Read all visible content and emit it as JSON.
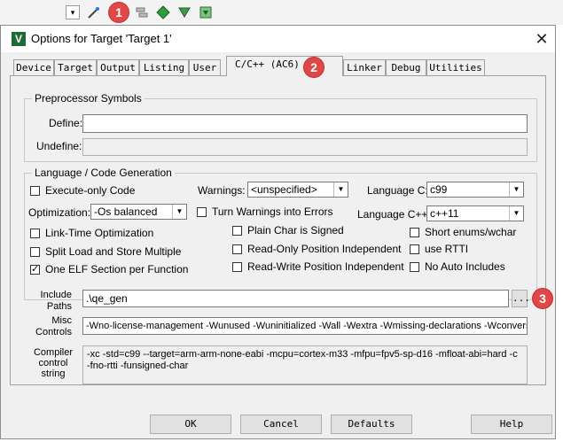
{
  "badges": {
    "b1": "1",
    "b2": "2",
    "b3": "3"
  },
  "toolbar_icons": [
    "dropdown-icon",
    "magic-wand-icon",
    "stack-icon",
    "green-diamond-icon",
    "translate-icon",
    "download-icon"
  ],
  "dialog": {
    "title": "Options for Target 'Target 1'",
    "close_symbol": "✕",
    "tabs": [
      "Device",
      "Target",
      "Output",
      "Listing",
      "User",
      "C/C++ (AC6)",
      "Linker",
      "Debug",
      "Utilities"
    ],
    "preprocessor": {
      "title": "Preprocessor Symbols",
      "define_label": "Define:",
      "define_value": "",
      "undefine_label": "Undefine:",
      "undefine_value": ""
    },
    "language": {
      "title": "Language / Code Generation",
      "execute_only": "Execute-only Code",
      "warnings_label": "Warnings:",
      "warnings_value": "<unspecified>",
      "language_c_label": "Language C:",
      "language_c_value": "c99",
      "optimization_label": "Optimization:",
      "optimization_value": "-Os balanced",
      "turn_warnings_errors": "Turn Warnings into Errors",
      "language_cpp_label": "Language C++:",
      "language_cpp_value": "c++11",
      "link_time_opt": "Link-Time Optimization",
      "plain_char_signed": "Plain Char is Signed",
      "short_enums": "Short enums/wchar",
      "split_load_store": "Split Load and Store Multiple",
      "readonly_pos_indep": "Read-Only Position Independent",
      "use_rtti": "use RTTI",
      "one_elf_section": "One ELF Section per Function",
      "readwrite_pos_indep": "Read-Write Position Independent",
      "no_auto_includes": "No Auto Includes"
    },
    "include_paths_label": "Include\nPaths",
    "include_paths_value": ".\\qe_gen",
    "browse_label": "...",
    "misc_controls_label": "Misc\nControls",
    "misc_controls_value": "-Wno-license-management -Wunused -Wuninitialized -Wall -Wextra -Wmissing-declarations -Wconversion",
    "compiler_control_label": "Compiler\ncontrol\nstring",
    "compiler_control_value": "-xc -std=c99 --target=arm-arm-none-eabi -mcpu=cortex-m33 -mfpu=fpv5-sp-d16 -mfloat-abi=hard -c\n-fno-rtti -funsigned-char",
    "buttons": {
      "ok": "OK",
      "cancel": "Cancel",
      "defaults": "Defaults",
      "help": "Help"
    }
  }
}
